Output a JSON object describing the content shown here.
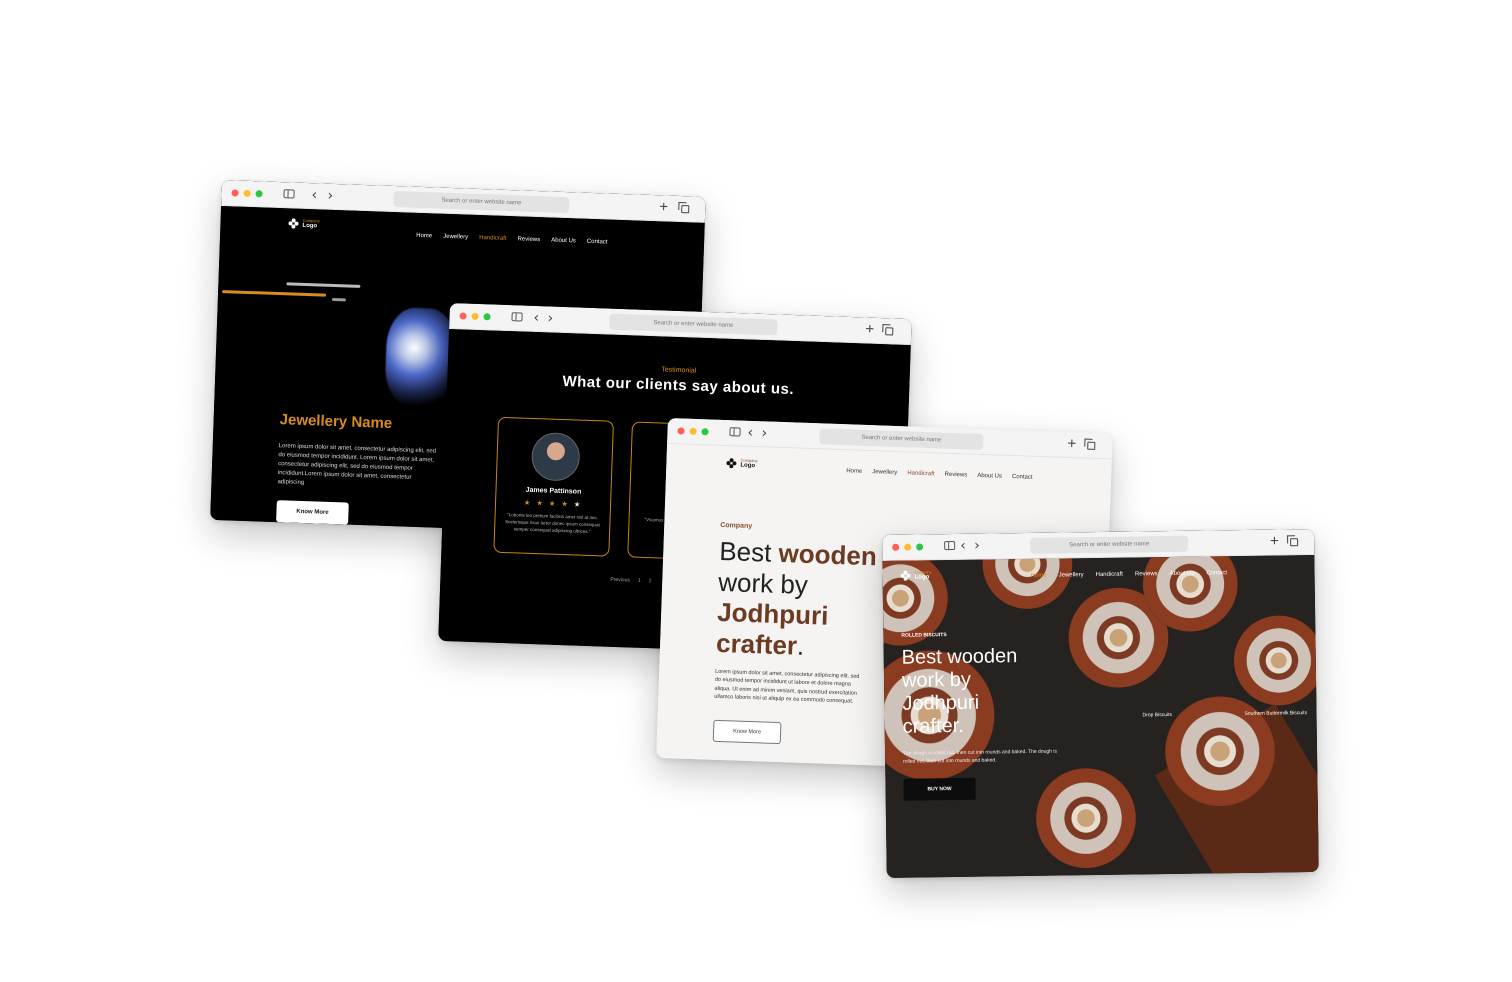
{
  "browser": {
    "address_placeholder": "Search or enter website name",
    "back_glyph": "‹",
    "forward_glyph": "›",
    "new_tab_glyph": "+"
  },
  "logo": {
    "small": "Company",
    "large": "Logo"
  },
  "nav": [
    "Home",
    "Jewellery",
    "Handicraft",
    "Reviews",
    "About Us",
    "Contact"
  ],
  "colors": {
    "gold": "#d88c1e",
    "brown": "#6b3b22",
    "dark": "#000000"
  },
  "window_1": {
    "active_nav": "Handicraft",
    "title": "Jewellery Name",
    "paragraph": "Lorem ipsum dolor sit amet, consectetur adipiscing elit, sed do eiusmod tempor incididunt. Lorem ipsum dolor sit amet, consectetur adipiscing elit, sed do eiusmod tempor incididunt.Lorem ipsum dolor sit amet, consectetur adipiscing",
    "button": "Know More"
  },
  "window_2": {
    "eyebrow": "Testimonial",
    "heading": "What our clients say about us.",
    "card": {
      "name": "James Pattinson",
      "stars_filled": "★ ★ ★ ★",
      "stars_empty": "★",
      "rating": 4,
      "quote": "\"Lobortis leo pretium facilisis amet nisl at nec. Scelerisque risus tortor donec ipsum consequat semper consequat adipiscing ultrices.\""
    },
    "card2_quote": "\"Vivamus consectetur eget... accumsan...\"",
    "pager": {
      "previous": "Previous",
      "page_1": "1",
      "page_2": "2"
    }
  },
  "window_3": {
    "active_nav": "Handicraft",
    "eyebrow": "Company",
    "heading_line1_plain": "Best ",
    "heading_line1_bold": "wooden",
    "heading_line2": "work by",
    "heading_line3": "Jodhpuri",
    "heading_line4": "crafter",
    "heading_dot": ".",
    "paragraph": "Lorem ipsum dolor sit amet, consectetur adipiscing elit, sed do eiusmod tempor incididunt ut labore et dolore magna aliqua. Ut enim ad minim veniam, quis nostrud exercitation ullamco laboris nisi ut aliquip ex ea commodo consequat.",
    "button": "Know More"
  },
  "window_4": {
    "active_nav": "Home",
    "eyebrow": "ROLLED BISCUITS",
    "heading": [
      "Best wooden",
      "work by",
      "Jodhpuri",
      "crafter."
    ],
    "paragraph": "The dough is rolled out, then cut into rounds and baked. The dough is rolled out, then cut into rounds and baked.",
    "button": "BUY NOW",
    "caption_1": "Drop Biscuits",
    "caption_2": "Southern Buttermilk Biscuits"
  }
}
